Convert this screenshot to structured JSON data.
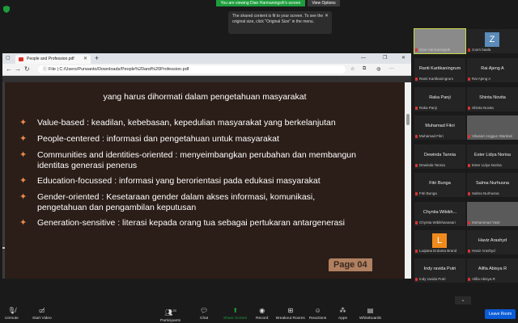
{
  "meeting": {
    "banner": "You are viewing Dian Harmaningsih's screen",
    "view_options": "View Options",
    "tooltip": "The shared content is fit to your screen. To see the original size, click \"Original Size\" in the menu."
  },
  "browser": {
    "tab_title": "People and Profession.pdf",
    "file_label": "File",
    "url": "C:/Users/Purwanto/Downloads/People%20and%20Profession.pdf"
  },
  "slide": {
    "title": "yang harus dihormati dalam pengetahuan masyarakat",
    "bullets": [
      "Value-based : keadilan, kebebasan, kepedulian masyarakat yang berkelanjutan",
      "People-centered : informasi dan pengetahuan untuk masyarakat",
      "Communities and identities-oriented : menyeimbangkan perubahan dan membangun",
      "identitas generasi penerus",
      "Education-focussed : informasi yang berorientasi pada edukasi masyarakat",
      "Gender-oriented : Kesetaraan gender dalam akses informasi, komunikasi,",
      "pengetahuan dan pengambilan keputusan",
      "Generation-sensitive : literasi kepada orang tua sebagai pertukaran antargenerasi"
    ],
    "page_label": "Page 04"
  },
  "gallery": [
    {
      "name": "",
      "sub": "Dian Harmaningsih",
      "video": true
    },
    {
      "name": "Z",
      "sub": "zoom baala",
      "video": false
    },
    {
      "name": "Ranti Kartikaningrum",
      "sub": "Ranti Kartikaningrum",
      "video": false
    },
    {
      "name": "Rai Ajeng A",
      "sub": "Rai Ajeng A",
      "video": false
    },
    {
      "name": "Raka Panji",
      "sub": "Raka Panji",
      "video": false
    },
    {
      "name": "Shinta Novita",
      "sub": "Shinta Novita",
      "video": false
    },
    {
      "name": "Muhamad Fikri",
      "sub": "Muhamad Fikri",
      "video": false
    },
    {
      "name": "",
      "sub": "Vikasari Anggun Wardani",
      "video": true
    },
    {
      "name": "Dewinda Tannia",
      "sub": "Dewinda Tannia",
      "video": false
    },
    {
      "name": "Ester Lidya Norisa",
      "sub": "Ester Lidya Norisa",
      "video": false
    },
    {
      "name": "Fitri Bunga",
      "sub": "Fitri Bunga",
      "video": false
    },
    {
      "name": "Salma Nurhusna",
      "sub": "Salma Nurhusna",
      "video": false
    },
    {
      "name": "Chyntia Wibikh...",
      "sub": "Chyntia Wibikhanasari",
      "video": false
    },
    {
      "name": "",
      "sub": "Muhammad Yasir",
      "video": true
    },
    {
      "name": "L",
      "sub": "Luqiana Erdanta Brand",
      "video": false
    },
    {
      "name": "Haviz Arashyd",
      "sub": "Haviz Arashyd",
      "video": false
    },
    {
      "name": "Indy ravida Putri",
      "sub": "Indy ravida Putri",
      "video": false
    },
    {
      "name": "Alifia Abisya R",
      "sub": "Alifia Abisya R",
      "video": false
    }
  ],
  "toolbar": {
    "unmute": "Unmute",
    "start_video": "Start Video",
    "participants": "Participants",
    "participants_count": "20",
    "chat": "Chat",
    "share_screen": "Share Screen",
    "record": "Record",
    "breakout": "Breakout Rooms",
    "reactions": "Reactions",
    "apps": "Apps",
    "whiteboards": "Whiteboards",
    "leave": "Leave Room"
  },
  "colors": {
    "accent_green": "#1d9d3c",
    "leave_blue": "#0b5cd7",
    "bullet_orange": "#e98a4c",
    "slide_bg": "#2b1d17"
  }
}
